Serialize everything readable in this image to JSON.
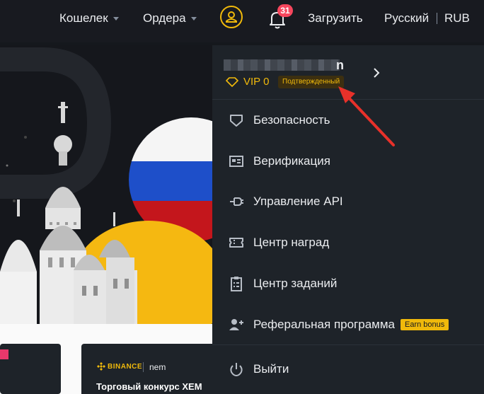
{
  "nav": {
    "wallet": "Кошелек",
    "orders": "Ордера",
    "notifications_count": "31",
    "download": "Загрузить",
    "language": "Русский",
    "currency": "RUB"
  },
  "colors": {
    "accent": "#f0b90b",
    "badge_red": "#f6465d",
    "panel_bg": "#1e2329",
    "arrow": "#e8312a"
  },
  "profile": {
    "username_visible_tail": "n",
    "vip": "VIP 0",
    "status": "Подтвержденный"
  },
  "menu": [
    {
      "icon": "shield-icon",
      "label": "Безопасность"
    },
    {
      "icon": "id-card-icon",
      "label": "Верификация"
    },
    {
      "icon": "api-plug-icon",
      "label": "Управление API"
    },
    {
      "icon": "ticket-icon",
      "label": "Центр наград"
    },
    {
      "icon": "clipboard-icon",
      "label": "Центр заданий"
    },
    {
      "icon": "add-user-icon",
      "label": "Реферальная программа",
      "badge": "Earn bonus"
    }
  ],
  "logout": {
    "icon": "power-icon",
    "label": "Выйти"
  },
  "promo_card": {
    "brand1": "BINANCE",
    "brand2": "nem",
    "title": "Торговый конкурс XEM"
  }
}
